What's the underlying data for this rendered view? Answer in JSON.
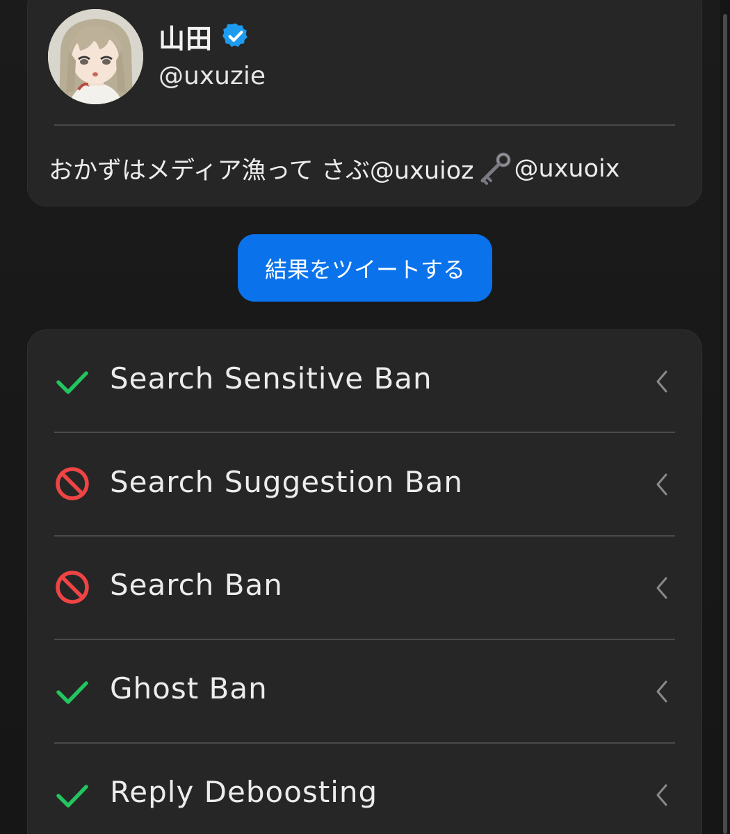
{
  "profile": {
    "display_name": "山田",
    "handle": "@uxuzie",
    "verified_icon": "verified-badge-icon",
    "bio": {
      "before_key": "おかずはメディア漁って さぶ@uxuioz",
      "key_icon": "key-emoji-icon",
      "after_key": "@uxuoix"
    },
    "avatar_icon": "avatar-anime-girl"
  },
  "tweet_button": {
    "label": "結果をツイートする"
  },
  "results": [
    {
      "label": "Search Sensitive Ban",
      "status": "ok",
      "status_icon": "check-icon"
    },
    {
      "label": "Search Suggestion Ban",
      "status": "banned",
      "status_icon": "prohibited-icon"
    },
    {
      "label": "Search Ban",
      "status": "banned",
      "status_icon": "prohibited-icon"
    },
    {
      "label": "Ghost Ban",
      "status": "ok",
      "status_icon": "check-icon"
    },
    {
      "label": "Reply Deboosting",
      "status": "ok",
      "status_icon": "check-icon"
    }
  ],
  "colors": {
    "accent_blue": "#0a73ec",
    "verified_blue": "#1d9bf0",
    "ok_green": "#22c55e",
    "ban_red": "#ef4444",
    "card_bg": "#262626",
    "page_bg": "#181818"
  }
}
